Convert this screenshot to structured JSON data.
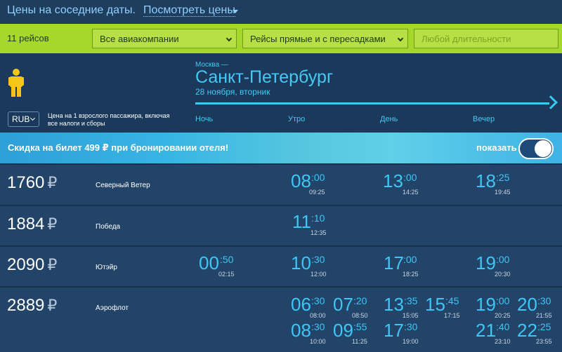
{
  "topbar": {
    "nearby_dates": "Цены на соседние даты.",
    "see_prices": "Посмотреть цены"
  },
  "filters": {
    "count": "11 рейсов",
    "airlines": "Все авиакомпании",
    "flights": "Рейсы прямые и с пересадками",
    "duration_placeholder": "Любой длительности"
  },
  "hero": {
    "currency": "RUB",
    "price_note": "Цена на 1 взрослого пассажира, включая все налоги и сборы",
    "from": "Москва —",
    "to": "Санкт-Петербург",
    "date": "28 ноября, вторник",
    "times_of_day": [
      "Ночь",
      "Утро",
      "День",
      "Вечер"
    ]
  },
  "banner": {
    "text": "Скидка на билет 499 ₽ при бронировании отеля!",
    "show_label": "показать"
  },
  "rows": [
    {
      "price": "1760",
      "currency": "₽",
      "airline": "Северный Ветер",
      "flights": [
        {
          "hh": "08",
          "mm": ":00",
          "arr": "09:25"
        },
        {
          "hh": "13",
          "mm": ":00",
          "arr": "14:25"
        },
        {
          "hh": "18",
          "mm": ":25",
          "arr": "19:45"
        }
      ]
    },
    {
      "price": "1884",
      "currency": "₽",
      "airline": "Победа",
      "flights": [
        {
          "hh": "11",
          "mm": ":10",
          "arr": "12:35"
        }
      ]
    },
    {
      "price": "2090",
      "currency": "₽",
      "airline": "Ютэйр",
      "flights": [
        {
          "hh": "00",
          "mm": ":50",
          "arr": "02:15"
        },
        {
          "hh": "10",
          "mm": ":30",
          "arr": "12:00"
        },
        {
          "hh": "17",
          "mm": ":00",
          "arr": "18:25"
        },
        {
          "hh": "19",
          "mm": ":00",
          "arr": "20:30"
        }
      ]
    },
    {
      "price": "2889",
      "currency": "₽",
      "airline": "Аэрофлот",
      "flights": [
        {
          "hh": "06",
          "mm": ":30",
          "arr": "08:00"
        },
        {
          "hh": "07",
          "mm": ":20",
          "arr": "08:50"
        },
        {
          "hh": "13",
          "mm": ":35",
          "arr": "15:05"
        },
        {
          "hh": "15",
          "mm": ":45",
          "arr": "17:15"
        },
        {
          "hh": "19",
          "mm": ":00",
          "arr": "20:25"
        },
        {
          "hh": "20",
          "mm": ":30",
          "arr": "21:55"
        },
        {
          "hh": "08",
          "mm": ":30",
          "arr": "10:00"
        },
        {
          "hh": "09",
          "mm": ":55",
          "arr": "11:25"
        },
        {
          "hh": "17",
          "mm": ":30",
          "arr": "19:00"
        },
        {
          "hh": "21",
          "mm": ":40",
          "arr": "23:10"
        },
        {
          "hh": "22",
          "mm": ":25",
          "arr": "23:55"
        }
      ]
    }
  ]
}
